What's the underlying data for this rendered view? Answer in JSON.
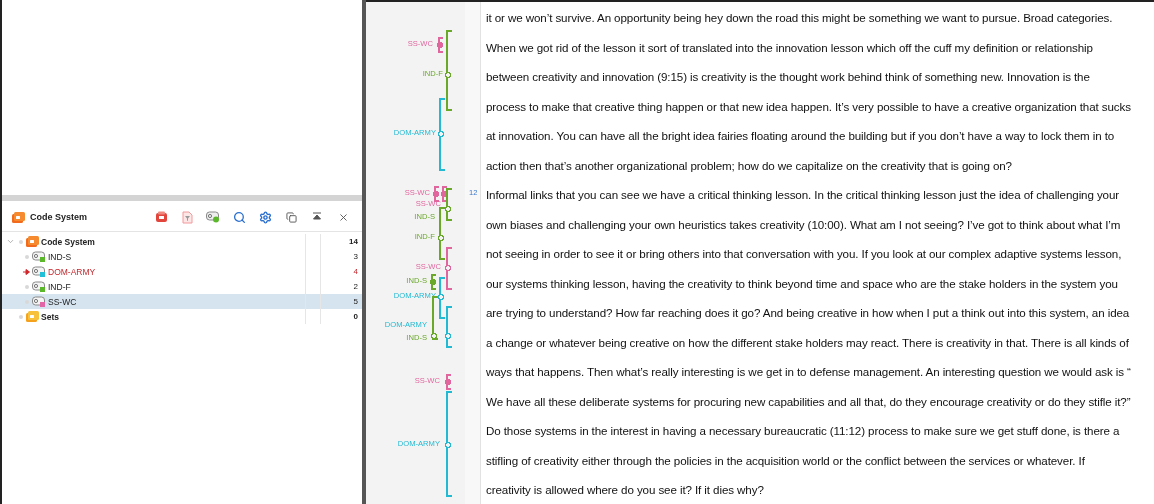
{
  "code_system_panel": {
    "title": "Code System",
    "tree": [
      {
        "label": "Code System",
        "count": "14",
        "expanded": true,
        "kind": "root",
        "children": [
          {
            "label": "IND-S",
            "count": "3",
            "color": "#5bb82a",
            "active": false,
            "selected": false
          },
          {
            "label": "DOM-ARMY",
            "count": "4",
            "color": "#1fc0d8",
            "active": true,
            "selected": false
          },
          {
            "label": "IND-F",
            "count": "2",
            "color": "#5bb82a",
            "active": false,
            "selected": false
          },
          {
            "label": "SS-WC",
            "count": "5",
            "color": "#e266a6",
            "active": false,
            "selected": true
          }
        ]
      },
      {
        "label": "Sets",
        "count": "0",
        "kind": "sets"
      }
    ]
  },
  "margin_codes": [
    {
      "label": "SS-WC",
      "color": "#e2669e",
      "kind": "mark"
    },
    {
      "label": "IND-F",
      "color": "#6aa82a",
      "kind": "span"
    },
    {
      "label": "DOM-ARMY",
      "color": "#22b9d2",
      "kind": "span"
    },
    {
      "label": "SS-WC",
      "color": "#e2669e",
      "kind": "mark"
    },
    {
      "label": "SS-WC",
      "color": "#e2669e",
      "kind": "mark"
    },
    {
      "label": "IND-S",
      "color": "#6aa82a",
      "kind": "span"
    },
    {
      "label": "IND-F",
      "color": "#6aa82a",
      "kind": "span"
    },
    {
      "label": "SS-WC",
      "color": "#e2669e",
      "kind": "span"
    },
    {
      "label": "IND-S",
      "color": "#6aa82a",
      "kind": "mark"
    },
    {
      "label": "DOM-ARMY",
      "color": "#22b9d2",
      "kind": "span"
    },
    {
      "label": "DOM-ARMY",
      "color": "#22b9d2",
      "kind": "span"
    },
    {
      "label": "IND-S",
      "color": "#6aa82a",
      "kind": "span"
    },
    {
      "label": "SS-WC",
      "color": "#e2669e",
      "kind": "mark"
    },
    {
      "label": "DOM-ARMY",
      "color": "#22b9d2",
      "kind": "span"
    }
  ],
  "document": {
    "paragraphs": [
      {
        "lines": [
          "it or we won’t survive. An opportunity being hey down the road this might be something we want to pursue. Broad categories.",
          "When we got rid of the lesson it sort of translated into the innovation lesson which off the cuff my definition or relationship",
          "between creativity and innovation (9:15) is creativity is the thought work behind think of something new. Innovation is the",
          "process to make that creative thing happen or that new idea happen. It’s very possible to have a creative organization that sucks",
          "at innovation. You can have all the bright idea fairies floating around the building but if you don’t have a way to lock them in to",
          "action then that’s another organizational problem; how do we capitalize on the creativity that is going on?"
        ]
      },
      {
        "number": "12",
        "lines": [
          "Informal links that you can see we have a critical thinking lesson. In the critical thinking lesson just the idea of challenging your",
          "own biases and challenging your own heuristics takes creativity (10:00). What am I not seeing? I’ve got to think about what I’m",
          "not seeing in order to see it or bring others into that conversation with you. If you look at our complex adaptive systems lesson,",
          "our systems thinking lesson, having the creativity to think beyond time and space who are the stake holders in the system you",
          "are trying to understand? How far reaching does it go? And being creative in how when I put a think out into this system, an idea",
          "a change or whatever being creative on how the different stake holders may react. There is creativity in that. There is all kinds of",
          "ways that happens. Then what’s really interesting is we get in to defense management. An interesting question we would ask is “",
          "We have all these deliberate systems for procuring new capabilities and all that, do they encourage creativity or do they stifle it?”",
          "Do those systems in the interest in having a necessary bureaucratic (11:12) process to make sure we get stuff done, is there a",
          "stifling of creativity either through the policies in the acquisition world or the conflict between the services or whatever. If",
          "creativity is allowed where do you see it? If it dies why?"
        ]
      }
    ]
  }
}
